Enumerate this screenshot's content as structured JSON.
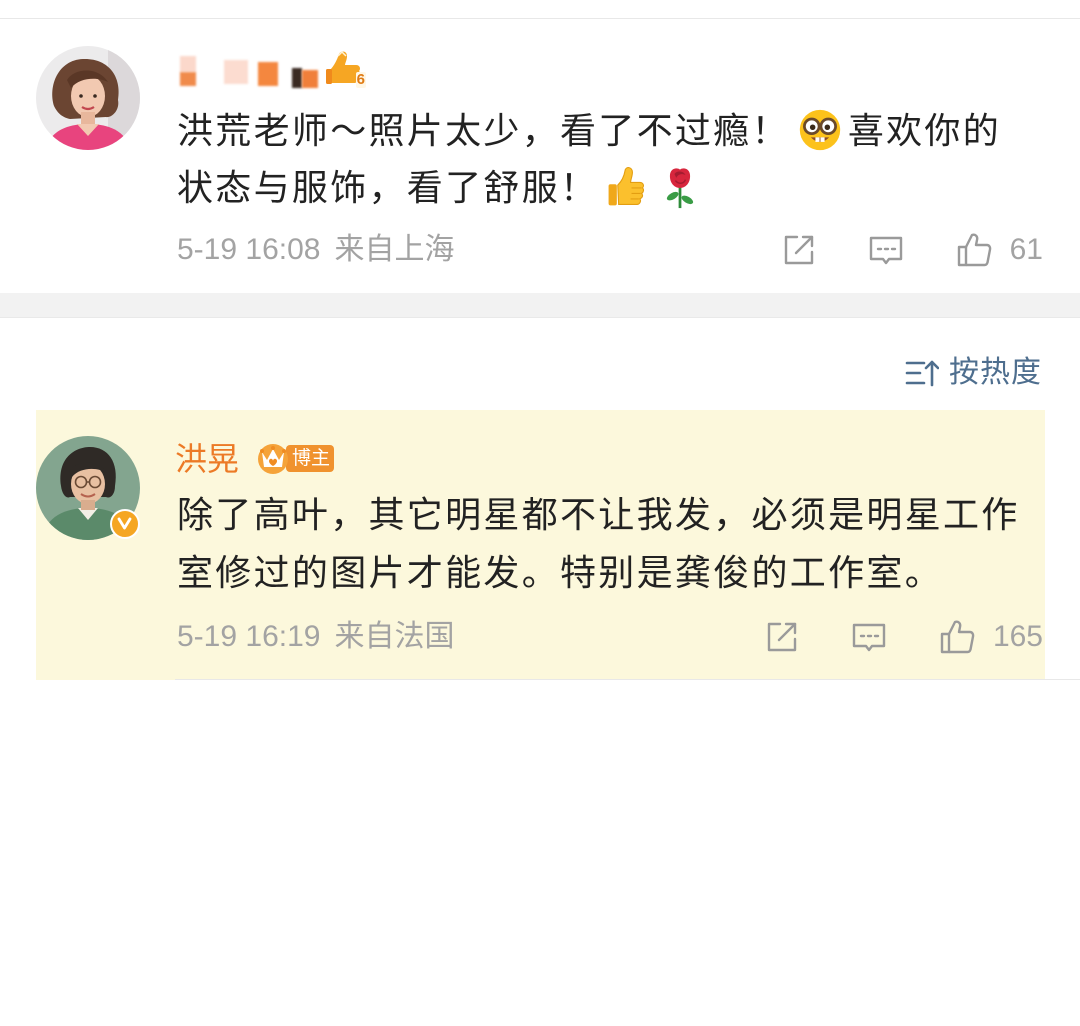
{
  "comments": [
    {
      "level_badge": "6",
      "text": {
        "line1_a": "洪荒老师～照片太少，看了不过瘾！",
        "line1_b": "喜欢你的",
        "line2": "状态与服饰，看了舒服！"
      },
      "emoji": [
        "nerd-face",
        "thumbs-up",
        "rose"
      ],
      "time": "5-19 16:08",
      "location": "来自上海",
      "like_count": "61"
    },
    {
      "author_name": "洪晃",
      "author_badge": "博主",
      "verified": true,
      "text": {
        "line1": "除了高叶，其它明星都不让我发，必须是明星工作",
        "line2": "室修过的图片才能发。特别是龚俊的工作室。"
      },
      "time": "5-19 16:19",
      "location": "来自法国",
      "like_count": "165"
    }
  ],
  "sort": {
    "label": "按热度",
    "icon": "sort-icon"
  },
  "action_icons": [
    "share-icon",
    "comment-icon",
    "like-icon"
  ],
  "colors": {
    "text": "#222222",
    "meta": "#a3a3a3",
    "author_name": "#ec7a26",
    "highlight_bg": "#fcf8dc",
    "sort": "#4e6e8e",
    "band": "#f2f2f2",
    "verified": "#f5a623",
    "badge": "#f0922e"
  }
}
